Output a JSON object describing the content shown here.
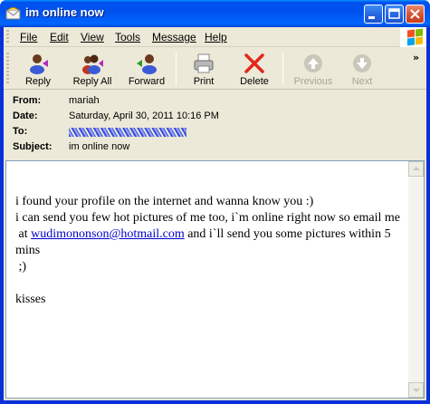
{
  "window": {
    "title": "im online now"
  },
  "menu": {
    "items": [
      {
        "label": "File"
      },
      {
        "label": "Edit"
      },
      {
        "label": "View"
      },
      {
        "label": "Tools"
      },
      {
        "label": "Message"
      },
      {
        "label": "Help"
      }
    ]
  },
  "toolbar": {
    "reply": "Reply",
    "reply_all": "Reply All",
    "forward": "Forward",
    "print": "Print",
    "delete": "Delete",
    "previous": "Previous",
    "next": "Next",
    "more": "»"
  },
  "header": {
    "from_label": "From:",
    "from_value": "mariah",
    "date_label": "Date:",
    "date_value": "Saturday, April 30, 2011 10:16 PM",
    "to_label": "To:",
    "subject_label": "Subject:",
    "subject_value": "im online now"
  },
  "body": {
    "line1": "i found your profile on the internet and wanna know you :)",
    "line2": "i can send you few hot pictures of me too, i`m online right now so email me",
    "line3_prefix": " at ",
    "email_link": "wudimononson@hotmail.com",
    "line3_suffix": " and i`ll send you some pictures within 5 mins",
    "line4": " ;)",
    "line5": "kisses"
  },
  "colors": {
    "titlebar": "#0053ee",
    "face": "#ece9d8",
    "link": "#0000cc"
  }
}
